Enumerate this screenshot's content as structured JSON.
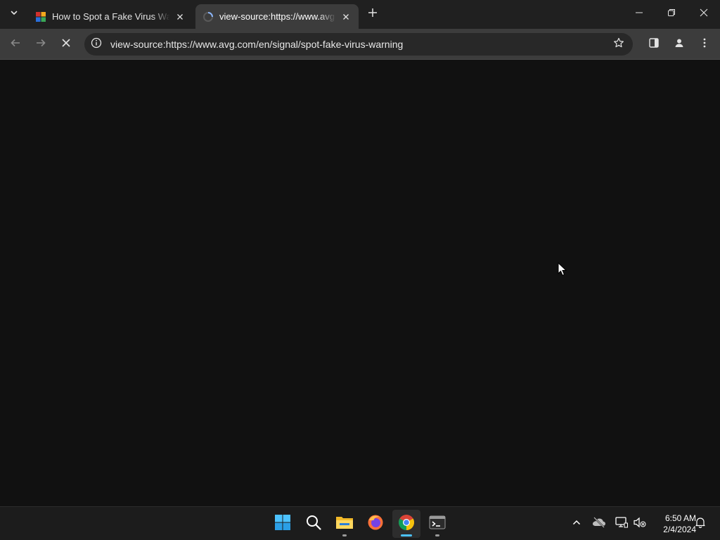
{
  "browser": {
    "tabs": [
      {
        "title": "How to Spot a Fake Virus Warning",
        "active": false,
        "favicon": "avg-logo-icon"
      },
      {
        "title": "view-source:https://www.avg.com/en/signal/spot-fake-virus-warning",
        "active": true,
        "favicon": "loading-spinner-icon"
      }
    ],
    "address_bar": {
      "url": "view-source:https://www.avg.com/en/signal/spot-fake-virus-warning"
    },
    "colors": {
      "tabstrip": "#202020",
      "toolbar": "#3c3c3c",
      "omnibox": "#282828",
      "content": "#111111"
    }
  },
  "taskbar": {
    "apps": [
      "windows-start-icon",
      "search-icon",
      "file-explorer-icon",
      "firefox-icon",
      "chrome-icon",
      "terminal-icon"
    ],
    "clock": {
      "time": "6:50 AM",
      "date": "2/4/2024"
    },
    "colors": {
      "accent": "#4cc2ff"
    }
  }
}
